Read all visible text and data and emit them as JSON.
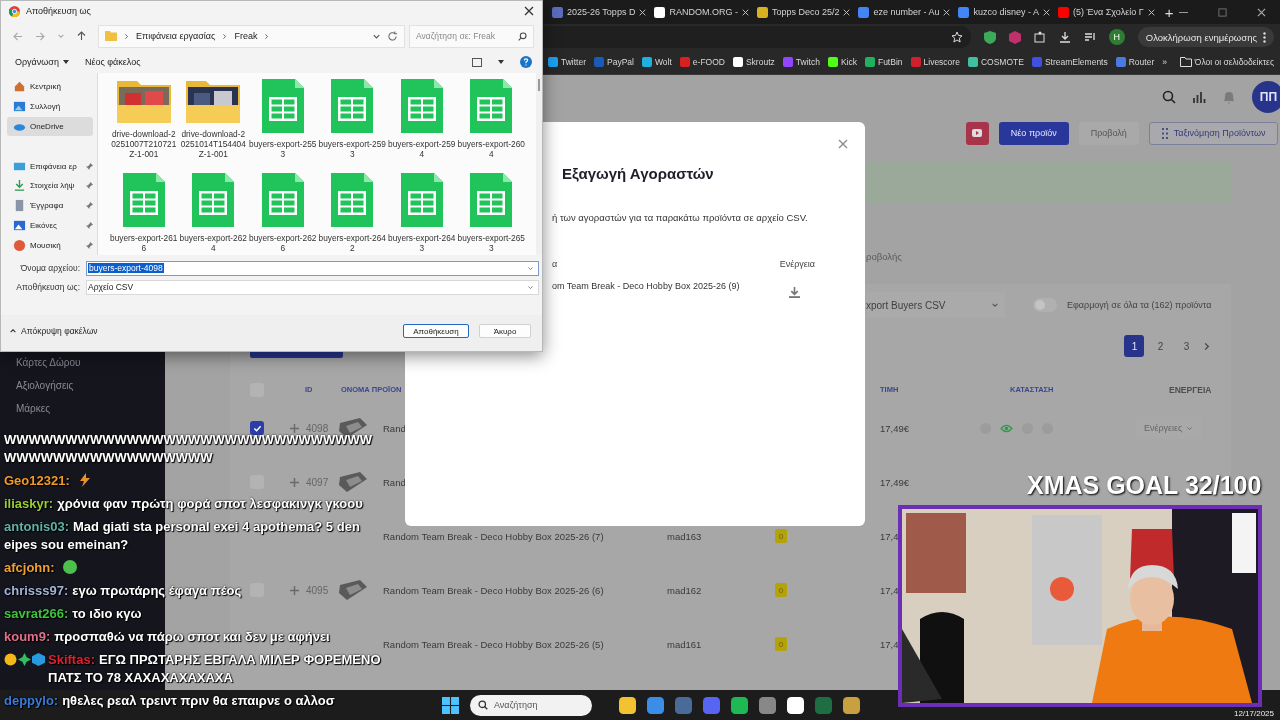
{
  "browser": {
    "tabs": [
      {
        "title": "2025-26 Topps D",
        "selected": false
      },
      {
        "title": "RANDOM.ORG -",
        "selected": false
      },
      {
        "title": "Topps Deco 25/2",
        "selected": false
      },
      {
        "title": "eze number - Au",
        "selected": false
      },
      {
        "title": "kuzco disney - A",
        "selected": false
      },
      {
        "title": "(5) Ένα Σχολείο Γ",
        "selected": false
      }
    ],
    "new_tab": "+",
    "profile_initial": "H",
    "update_button": "Ολοκλήρωση ενημέρωσης",
    "bookmarks": [
      "Twitter",
      "PayPal",
      "Wolt",
      "e-FOOD",
      "Skroutz",
      "Twitch",
      "Kick",
      "FutBin",
      "Livescore",
      "COSMOTE",
      "StreamElements",
      "Router"
    ],
    "more_bookmarks": "»",
    "all_bookmarks": "Όλοι οι σελιδοδείκτες"
  },
  "sidebar": {
    "items": [
      "Κάρτες Δώρου",
      "Αξιολογήσεις",
      "Μάρκες"
    ]
  },
  "header": {
    "avatar": "ΠΠ",
    "buttons": [
      {
        "label": "Νέο προϊόν",
        "kind": "primary"
      },
      {
        "label": "Προβολή",
        "kind": "plain"
      },
      {
        "label": "Ταξινόμηση Προϊόντων",
        "kind": "outline"
      }
    ]
  },
  "tab_label": "ροβολής",
  "filters": {
    "action": "xport Buyers CSV",
    "apply_all": {
      "label": "Εφαρμογή σε όλα τα (162) προϊόντα",
      "on": false
    }
  },
  "pagination": [
    {
      "label": "1",
      "selected": true
    },
    {
      "label": "2",
      "selected": false
    },
    {
      "label": "3",
      "selected": false
    }
  ],
  "table": {
    "select_all": false,
    "columns": [
      "ID",
      "ΟΝΟΜΑ ΠΡΟΪΟΝ",
      "ΤΙΜΗ",
      "ΚΑΤΑΣΤΑΣΗ",
      "ΕΝΕΡΓΕΙΑ"
    ],
    "rows": [
      {
        "checked": true,
        "id": "4098",
        "thumb": true,
        "name": "Rand",
        "price": "17,49€",
        "visible": true,
        "actions": "Ενέργειες"
      },
      {
        "checked": false,
        "id": "4097",
        "thumb": true,
        "name": "Rand",
        "price": "17,49€"
      },
      {
        "thumb": false,
        "name": "Random Team Break - Deco Hobby Box 2025-26 (7)",
        "seller": "mad163",
        "stock": "0",
        "price": "17,4"
      },
      {
        "checked": false,
        "id": "4095",
        "thumb": true,
        "name": "Random Team Break - Deco Hobby Box 2025-26 (6)",
        "seller": "mad162",
        "stock": "0",
        "price": "17,4"
      },
      {
        "thumb": false,
        "name": "Random Team Break - Deco Hobby Box 2025-26 (5)",
        "seller": "mad161",
        "stock": "0",
        "price": "17,4"
      }
    ]
  },
  "modal": {
    "title": "Εξαγωγή Αγοραστών",
    "description": "ή των αγοραστών για τα παρακάτω προϊόντα σε αρχείο CSV.",
    "columns": [
      "α",
      "Ενέργεια"
    ],
    "rows": [
      {
        "product": "om Team Break - Deco Hobby Box 2025-26 (9)"
      }
    ]
  },
  "dialog": {
    "title": "Αποθήκευση ως",
    "path": [
      "Επιφάνεια εργασίας",
      "Freak"
    ],
    "search_placeholder": "Αναζήτηση σε: Freak",
    "toolbar": [
      "Οργάνωση",
      "Νέος φάκελος"
    ],
    "nav": [
      {
        "label": "Κεντρική",
        "kind": "home",
        "pinned": false,
        "selected": false
      },
      {
        "label": "Συλλογή",
        "kind": "gallery",
        "pinned": false,
        "selected": false
      },
      {
        "label": "OneDrive",
        "kind": "cloud",
        "pinned": false,
        "selected": true
      },
      {
        "label": "Επιφάνεια ερ",
        "kind": "desktop",
        "pinned": true,
        "selected": false
      },
      {
        "label": "Στοιχεία λήψ",
        "kind": "download",
        "pinned": true,
        "selected": false
      },
      {
        "label": "Έγγραφα",
        "kind": "document",
        "pinned": true,
        "selected": false
      },
      {
        "label": "Εικόνες",
        "kind": "pictures",
        "pinned": true,
        "selected": false
      },
      {
        "label": "Μουσική",
        "kind": "music",
        "pinned": true,
        "selected": false
      }
    ],
    "files": [
      {
        "kind": "folder",
        "name": "drive-download-20251007T210721Z-1-001"
      },
      {
        "kind": "folder",
        "name": "drive-download-20251014T154404Z-1-001"
      },
      {
        "kind": "sheet",
        "name": "buyers-export-2553"
      },
      {
        "kind": "sheet",
        "name": "buyers-export-2593"
      },
      {
        "kind": "sheet",
        "name": "buyers-export-2594"
      },
      {
        "kind": "sheet",
        "name": "buyers-export-2604"
      },
      {
        "kind": "sheet",
        "name": "buyers-export-2616"
      },
      {
        "kind": "sheet",
        "name": "buyers-export-2624"
      },
      {
        "kind": "sheet",
        "name": "buyers-export-2626"
      },
      {
        "kind": "sheet",
        "name": "buyers-export-2642"
      },
      {
        "kind": "sheet",
        "name": "buyers-export-2643"
      },
      {
        "kind": "sheet",
        "name": "buyers-export-2653"
      }
    ],
    "file_name_label": "Όνομα αρχείου:",
    "file_name": "buyers-export-4098",
    "save_as_label": "Αποθήκευση ως:",
    "save_as": "Αρχείο CSV",
    "hide_folders": "Απόκρυψη φακέλων",
    "buttons": [
      {
        "label": "Αποθήκευση",
        "kind": "primary"
      },
      {
        "label": "Άκυρο",
        "kind": "secondary"
      }
    ]
  },
  "chat": [
    {
      "kind": "text",
      "text": "WWWWWWWWWWWWWWWWWWWWWWWWWWWWWWWWWWWWWWWWWWWWWWW"
    },
    {
      "kind": "emote",
      "user": "Geo12321:",
      "color": "#f09a28"
    },
    {
      "kind": "text",
      "user": "iliaskyr:",
      "color": "#9acd32",
      "text": "χρόνια φαν πρώτη φορά σποτ λεσφακινγκ γκοου"
    },
    {
      "kind": "text",
      "user": "antonis03:",
      "color": "#5fb3a8",
      "text": "Mad giati sta personal exei 4 apothema? 5 den eipes sou emeinan?"
    },
    {
      "kind": "emote",
      "user": "afcjohn:",
      "color": "#f0a030"
    },
    {
      "kind": "text",
      "user": "chrisss97:",
      "color": "#a0b4d8",
      "text": "εγω πρωτάρης έφαγα πέος"
    },
    {
      "kind": "text",
      "user": "savrat266:",
      "color": "#3ec43e",
      "text": "το ιδιο κγω"
    },
    {
      "kind": "text",
      "user": "koum9:",
      "color": "#e0708a",
      "text": "προσπαθώ να πάρω σποτ και δεν με αφήνει"
    },
    {
      "kind": "badged",
      "user": "Skiftas:",
      "color": "#e02030",
      "text": "ΕΓΩ ΠΡΩΤΑΡΗΣ ΕΒΓΑΛΑ ΜΙΛΕΡ ΦΟΡΕΜΕΝΟ ΠΑΤΣ ΤΟ 78 ΧΑΧΑΧΑΧΑΧΑΧΑ"
    },
    {
      "kind": "text",
      "user": "deppylo:",
      "color": "#3a7ad8",
      "text": "ηθελες ρεαλ τρειντ πριν θα επαιρνε ο αλλοσ"
    }
  ],
  "stream": {
    "goal": "XMAS GOAL 32/100"
  },
  "taskbar": {
    "search_placeholder": "Αναζήτηση",
    "date": "12/17/2025"
  }
}
